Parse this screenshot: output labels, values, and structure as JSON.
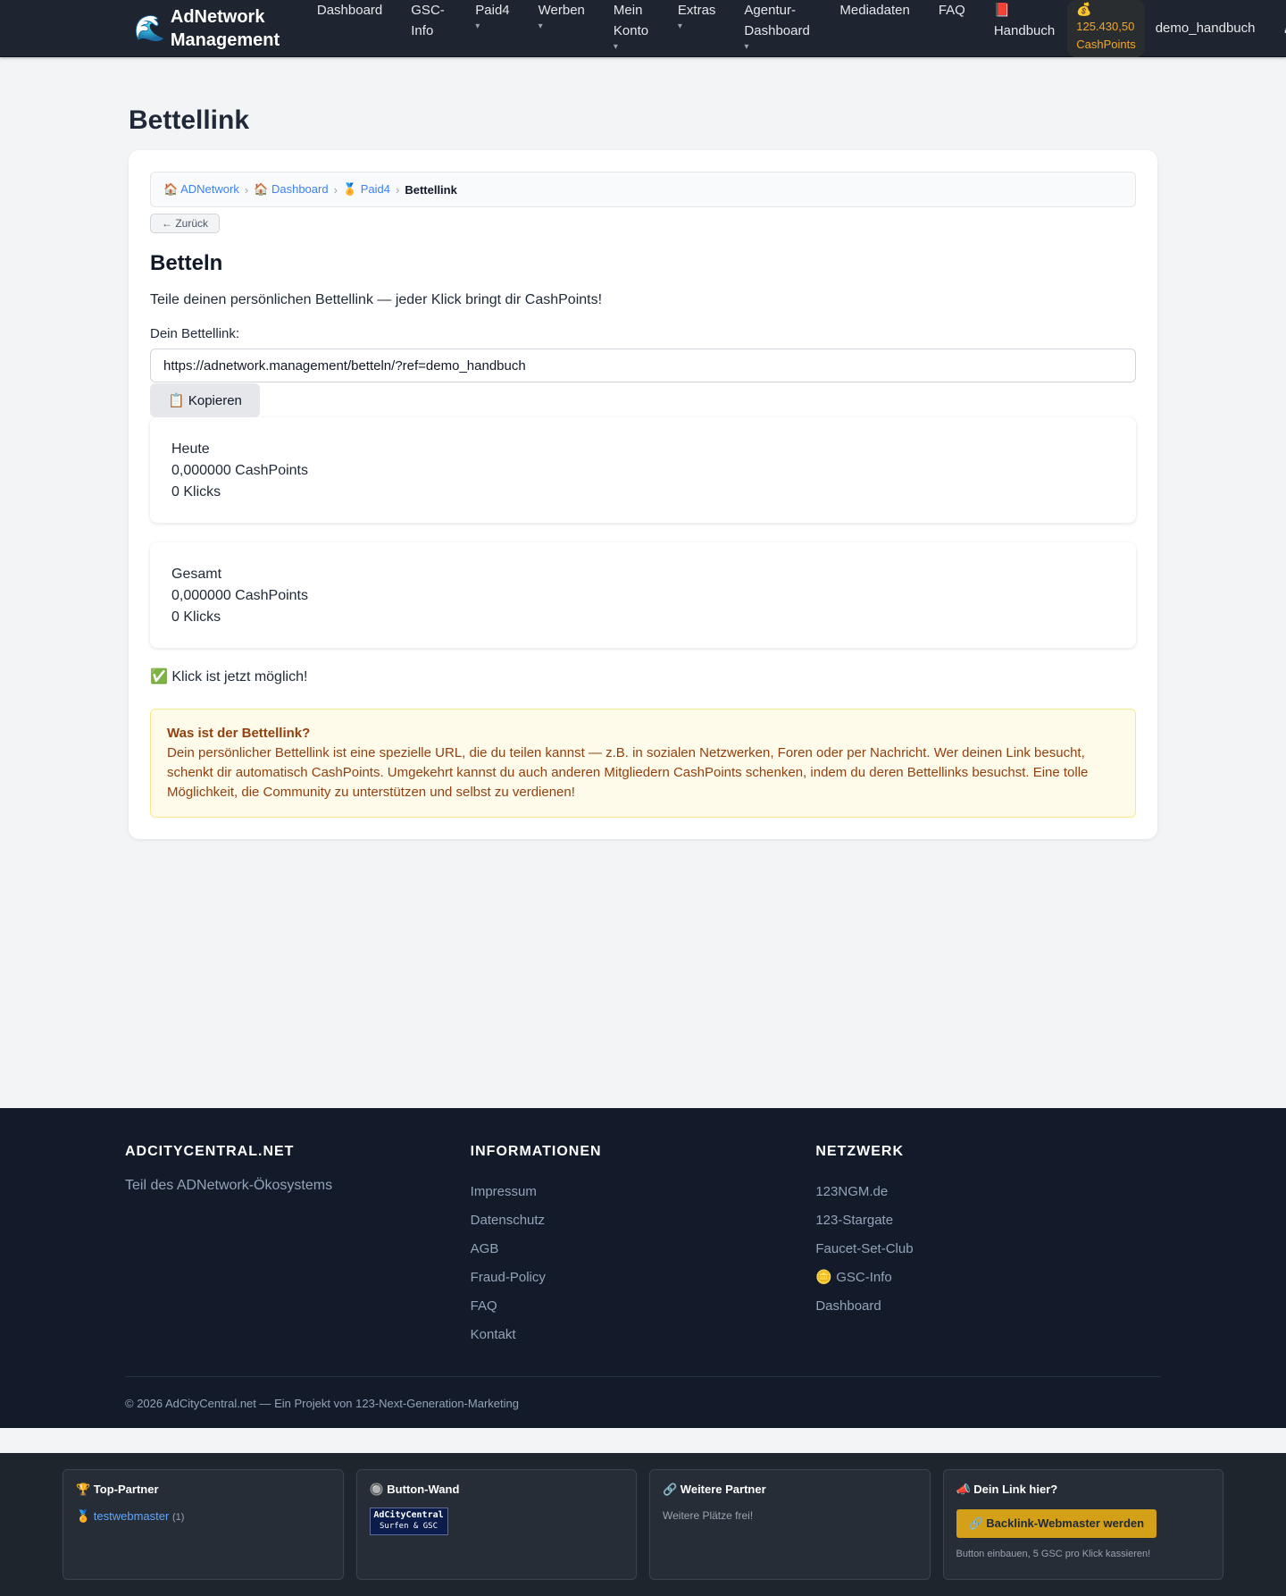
{
  "brand": {
    "logo": "🌊",
    "name": "AdNetwork Management"
  },
  "nav": {
    "dashboard": "Dashboard",
    "gsc_info": "GSC-Info",
    "paid4": "Paid4",
    "werben": "Werben",
    "mein_konto": "Mein Konto",
    "extras": "Extras",
    "agentur": "Agentur-Dashboard",
    "mediadaten": "Mediadaten",
    "faq": "FAQ",
    "caret": "▾",
    "handbuch_icon": "📕",
    "handbuch": "Handbuch",
    "cash_icon": "💰",
    "cash_value": "125.430,50",
    "cash_unit": "CashPoints",
    "user": "demo_handbuch",
    "logout_icon": "⏏"
  },
  "page": {
    "title": "Bettellink",
    "breadcrumb": {
      "home": "🏠 ADNetwork",
      "dashboard": "🏠 Dashboard",
      "paid4": "🏅 Paid4",
      "current": "Bettellink",
      "sep": "›"
    },
    "back": "← Zurück",
    "section_title": "Betteln",
    "description": "Teile deinen persönlichen Bettellink — jeder Klick bringt dir CashPoints!",
    "link_label": "Dein Bettellink:",
    "link_value": "https://adnetwork.management/betteln/?ref=demo_handbuch",
    "copy_button": "📋 Kopieren",
    "stats": {
      "today": {
        "label": "Heute",
        "cashpoints": "0,000000 CashPoints",
        "clicks": "0 Klicks"
      },
      "total": {
        "label": "Gesamt",
        "cashpoints": "0,000000 CashPoints",
        "clicks": "0 Klicks"
      }
    },
    "status": "✅ Klick ist jetzt möglich!",
    "info": {
      "title": "Was ist der Bettellink?",
      "text": "Dein persönlicher Bettellink ist eine spezielle URL, die du teilen kannst — z.B. in sozialen Netzwerken, Foren oder per Nachricht. Wer deinen Link besucht, schenkt dir automatisch CashPoints. Umgekehrt kannst du auch anderen Mitgliedern CashPoints schenken, indem du deren Bettellinks besuchst. Eine tolle Möglichkeit, die Community zu unterstützen und selbst zu verdienen!"
    }
  },
  "footer": {
    "col1": {
      "title": "ADCITYCENTRAL.NET",
      "tagline": "Teil des ADNetwork-Ökosystems"
    },
    "col2": {
      "title": "INFORMATIONEN",
      "links": [
        "Impressum",
        "Datenschutz",
        "AGB",
        "Fraud-Policy",
        "FAQ",
        "Kontakt"
      ]
    },
    "col3": {
      "title": "NETZWERK",
      "links": [
        "123NGM.de",
        "123-Stargate",
        "Faucet-Set-Club",
        "🪙 GSC-Info",
        "Dashboard"
      ]
    },
    "copyright": "© 2026 AdCityCentral.net — Ein Projekt von 123-Next-Generation-Marketing"
  },
  "partners": {
    "top": {
      "title": "🏆 Top-Partner",
      "link": "🏅 testwebmaster",
      "count": "(1)"
    },
    "wall": {
      "title": "🔘 Button-Wand",
      "btn_line1": "AdCityCentral",
      "btn_line2": "Surfen & GSC"
    },
    "more": {
      "title": "🔗 Weitere Partner",
      "text": "Weitere Plätze frei!"
    },
    "yours": {
      "title": "📣 Dein Link hier?",
      "button": "🔗 Backlink-Webmaster werden",
      "note": "Button einbauen, 5 GSC pro Klick kassieren!"
    }
  }
}
